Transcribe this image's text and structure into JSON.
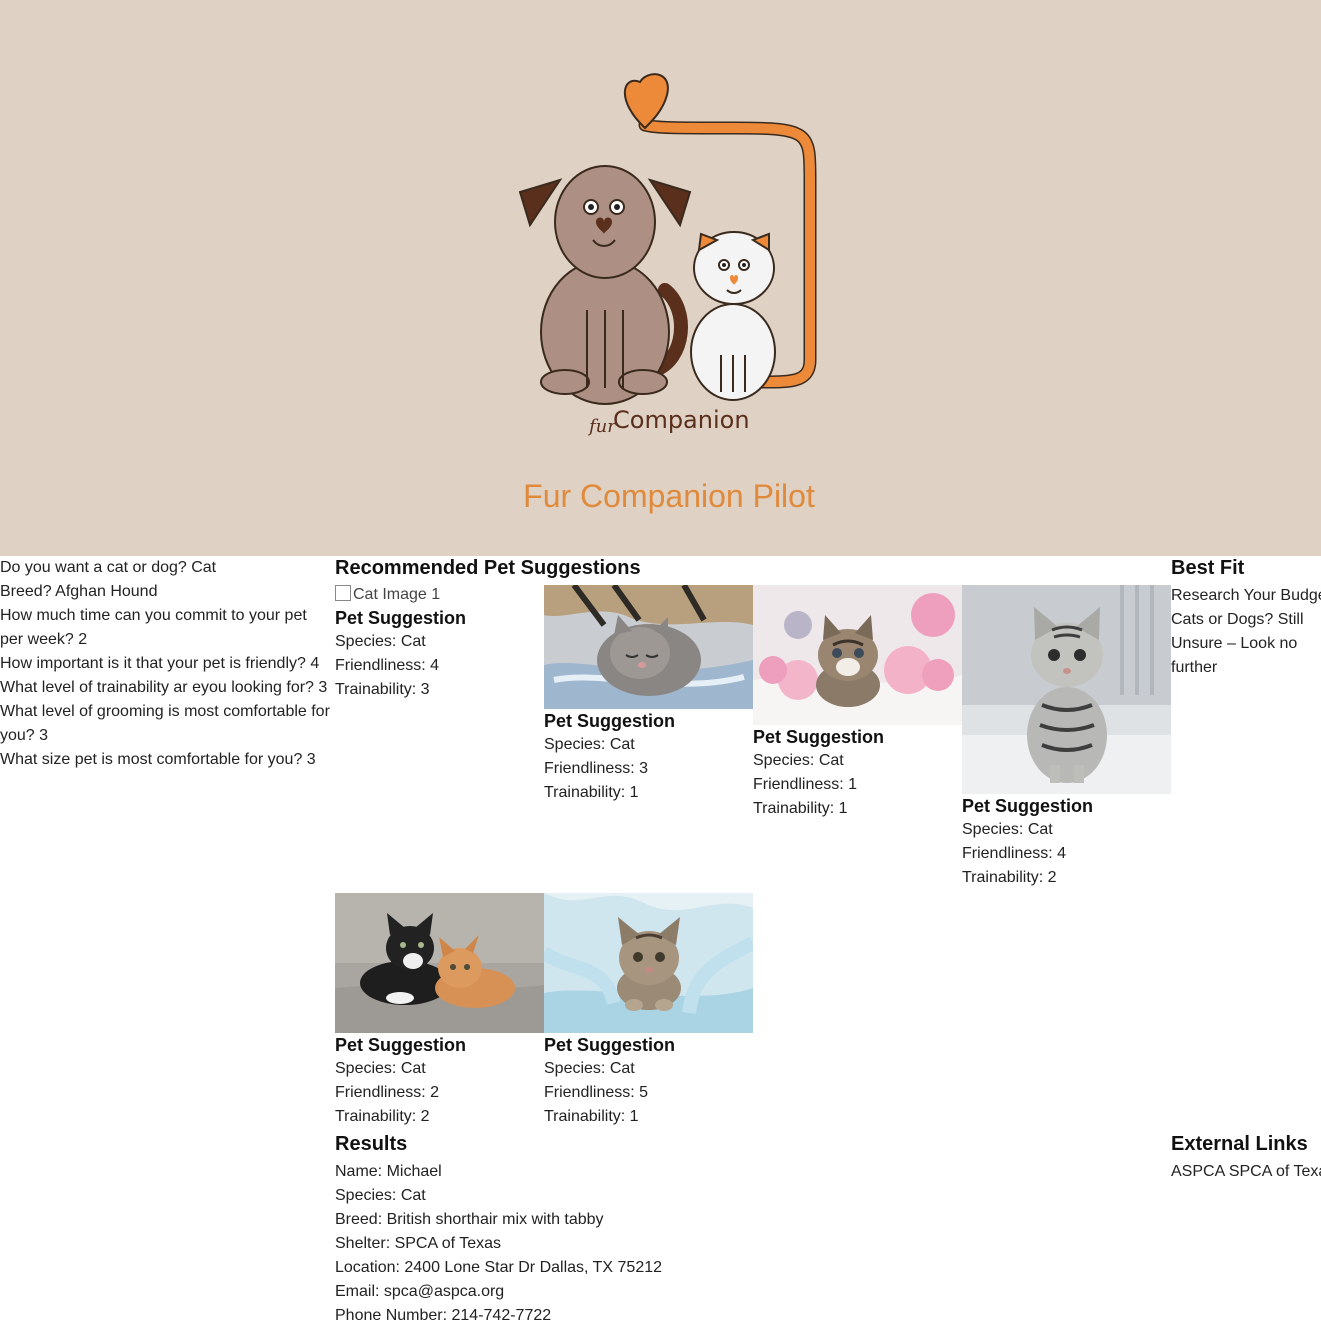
{
  "header": {
    "brand_small": "fur",
    "brand_large": "Companion",
    "site_title": "Fur Companion Pilot",
    "background_color": "#dfd2c5",
    "accent_color": "#e08a3c"
  },
  "questions": [
    "Do you want a cat or dog? Cat",
    "Breed? Afghan Hound",
    "How much time can you commit to your pet per week? 2",
    "How important is it that your pet is friendly? 4",
    "What level of trainability ar eyou looking for? 3",
    "What level of grooming is most comfortable for you? 3",
    "What size pet is most comfortable for you? 3"
  ],
  "suggestions": {
    "heading": "Recommended Pet Suggestions",
    "cards": [
      {
        "image_alt": "Cat Image 1",
        "image_broken": true,
        "title": "Pet Suggestion",
        "species": "Species: Cat",
        "friendliness": "Friendliness: 4",
        "trainability": "Trainability: 3"
      },
      {
        "image": "sleeping-kitten-photo",
        "title": "Pet Suggestion",
        "species": "Species: Cat",
        "friendliness": "Friendliness: 3",
        "trainability": "Trainability: 1"
      },
      {
        "image": "kitten-yarn-photo",
        "title": "Pet Suggestion",
        "species": "Species: Cat",
        "friendliness": "Friendliness: 1",
        "trainability": "Trainability: 1"
      },
      {
        "image": "silver-tabby-kitten-photo",
        "title": "Pet Suggestion",
        "species": "Species: Cat",
        "friendliness": "Friendliness: 4",
        "trainability": "Trainability: 2"
      },
      {
        "image": "two-kittens-photo",
        "title": "Pet Suggestion",
        "species": "Species: Cat",
        "friendliness": "Friendliness: 2",
        "trainability": "Trainability: 2"
      },
      {
        "image": "kitten-blanket-photo",
        "title": "Pet Suggestion",
        "species": "Species: Cat",
        "friendliness": "Friendliness: 5",
        "trainability": "Trainability: 1"
      }
    ]
  },
  "best_fit": {
    "heading": "Best Fit",
    "lines": [
      "Research Your Budge",
      "Cats or Dogs? Still",
      "Unsure – Look no",
      "further"
    ]
  },
  "results": {
    "heading": "Results",
    "lines": [
      "Name: Michael",
      "Species: Cat",
      "Breed: British shorthair mix with tabby",
      "Shelter: SPCA of Texas",
      "Location: 2400 Lone Star Dr Dallas, TX 75212",
      "Email: spca@aspca.org",
      "Phone Number: 214-742-7722"
    ]
  },
  "external_links": {
    "heading": "External Links",
    "links": [
      "ASPCA",
      "SPCA of Texa"
    ]
  }
}
